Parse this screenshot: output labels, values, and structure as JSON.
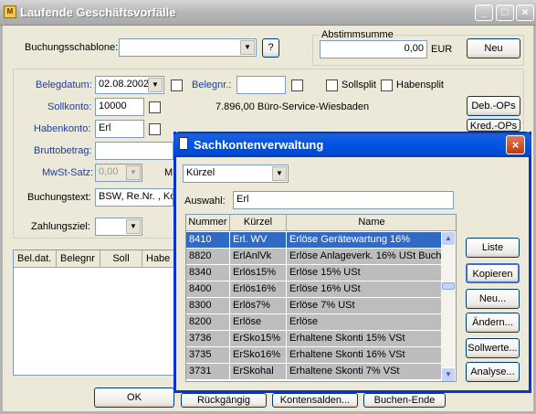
{
  "main": {
    "title": "Laufende Geschäftsvorfälle",
    "title_buttons": [
      "_",
      "□",
      "×"
    ],
    "buchungsschablone_label": "Buchungsschablone:",
    "help_label": "?",
    "abstimmsumme_label": "Abstimmsumme",
    "abstimmsumme_value": "0,00",
    "currency": "EUR",
    "neu_label": "Neu",
    "belegdatum_label": "Belegdatum:",
    "belegdatum_value": "02.08.2002",
    "belegnr_label": "Belegnr.:",
    "sollsplit_label": "Sollsplit",
    "habensplit_label": "Habensplit",
    "sollkonto_label": "Sollkonto:",
    "sollkonto_value": "10000",
    "sollkonto_info": "7.896,00 Büro-Service-Wiesbaden",
    "deb_ops_label": "Deb.-OPs",
    "habenkonto_label": "Habenkonto:",
    "habenkonto_value": "Erl",
    "kred_ops_label": "Kred.-OPs",
    "bruttobetrag_label": "Bruttobetrag:",
    "mwst_satz_label": "MwSt-Satz:",
    "mwst_value": "0,00",
    "mwst_partial": "M",
    "buchungstext_label": "Buchungstext:",
    "buchungstext_value": "BSW, Re.Nr. , Ko",
    "zahlungsziel_label": "Zahlungsziel:",
    "list_headers": [
      "Bel.dat.",
      "Belegnr",
      "Soll",
      "Habe"
    ],
    "bottom_buttons": [
      "OK",
      "Rückgängig",
      "Kontensalden...",
      "Buchen-Ende"
    ]
  },
  "dialog": {
    "title": "Sachkontenverwaltung",
    "close": "×",
    "sort_value": "Kürzel",
    "auswahl_label": "Auswahl:",
    "auswahl_value": "Erl",
    "columns": [
      "Nummer",
      "Kürzel",
      "Name"
    ],
    "rows": [
      {
        "nummer": "8410",
        "kuerzel": "Erl. WV",
        "name": "Erlöse Gerätewartung 16%",
        "selected": true
      },
      {
        "nummer": "8820",
        "kuerzel": "ErlAnlVk",
        "name": "Erlöse Anlageverk. 16% USt Buchg"
      },
      {
        "nummer": "8340",
        "kuerzel": "Erlös15%",
        "name": "Erlöse 15% USt"
      },
      {
        "nummer": "8400",
        "kuerzel": "Erlös16%",
        "name": "Erlöse 16% USt"
      },
      {
        "nummer": "8300",
        "kuerzel": "Erlös7%",
        "name": "Erlöse 7% USt"
      },
      {
        "nummer": "8200",
        "kuerzel": "Erlöse",
        "name": "Erlöse"
      },
      {
        "nummer": "3736",
        "kuerzel": "ErSko15%",
        "name": "Erhaltene Skonti 15% VSt"
      },
      {
        "nummer": "3735",
        "kuerzel": "ErSko16%",
        "name": "Erhaltene Skonti 16% VSt"
      },
      {
        "nummer": "3731",
        "kuerzel": "ErSkohal",
        "name": "Erhaltene Skonti 7% VSt"
      }
    ],
    "buttons": [
      "Liste",
      "Kopieren",
      "Neu...",
      "Ändern...",
      "Sollwerte...",
      "Analyse..."
    ]
  }
}
